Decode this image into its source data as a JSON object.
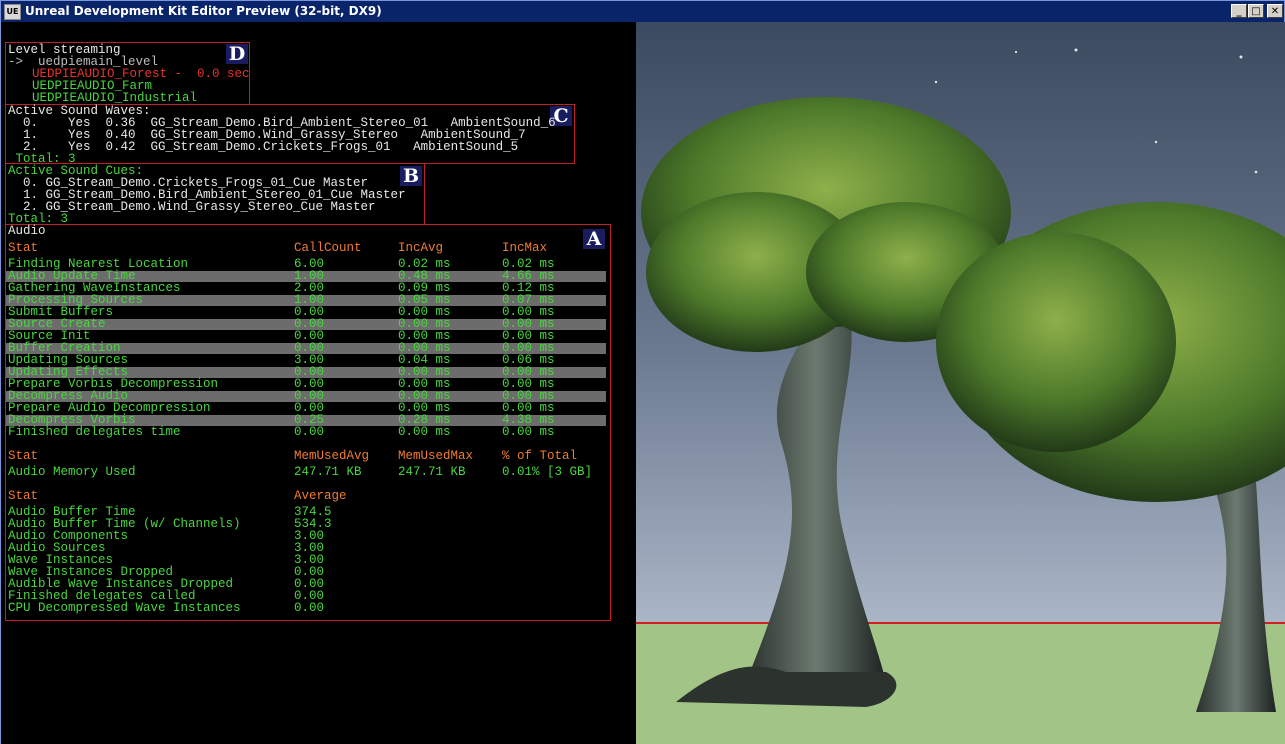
{
  "window": {
    "title": "Unreal Development Kit Editor Preview (32-bit, DX9)",
    "app_icon": "UE",
    "controls": {
      "minimize": "_",
      "maximize": "□",
      "close": "✕"
    }
  },
  "colors": {
    "green": "#49d640",
    "red": "#e8322a",
    "orange": "#f07a30",
    "white": "#e8e8e8",
    "box_border": "#c0202a",
    "tag_bg": "#1a1c60"
  },
  "level_streaming": {
    "tag": "D",
    "title": "Level streaming",
    "main": "->  uedpiemain_level",
    "levels": [
      {
        "text": "UEDPIEAUDIO_Forest -  0.0 sec",
        "color": "red"
      },
      {
        "text": "UEDPIEAUDIO_Farm",
        "color": "green"
      },
      {
        "text": "UEDPIEAUDIO_Industrial",
        "color": "green"
      }
    ]
  },
  "sound_waves": {
    "tag": "C",
    "title": "Active Sound Waves:",
    "rows": [
      "  0.    Yes  0.36  GG_Stream_Demo.Bird_Ambient_Stereo_01   AmbientSound_6",
      "  1.    Yes  0.40  GG_Stream_Demo.Wind_Grassy_Stereo   AmbientSound_7",
      "  2.    Yes  0.42  GG_Stream_Demo.Crickets_Frogs_01   AmbientSound_5"
    ],
    "total": " Total: 3"
  },
  "sound_cues": {
    "tag": "B",
    "title": "Active Sound Cues:",
    "rows": [
      "  0. GG_Stream_Demo.Crickets_Frogs_01_Cue Master",
      "  1. GG_Stream_Demo.Bird_Ambient_Stereo_01_Cue Master",
      "  2. GG_Stream_Demo.Wind_Grassy_Stereo_Cue Master"
    ],
    "total": "Total: 3"
  },
  "audio": {
    "tag": "A",
    "title": "Audio",
    "timing_header": [
      "Stat",
      "CallCount",
      "IncAvg",
      "IncMax"
    ],
    "timing_rows": [
      [
        "Finding Nearest Location",
        "6.00",
        "0.02 ms",
        "0.02 ms"
      ],
      [
        "Audio Update Time",
        "1.00",
        "0.48 ms",
        "4.66 ms"
      ],
      [
        "Gathering WaveInstances",
        "2.00",
        "0.09 ms",
        "0.12 ms"
      ],
      [
        "Processing Sources",
        "1.00",
        "0.05 ms",
        "0.07 ms"
      ],
      [
        "Submit Buffers",
        "0.00",
        "0.00 ms",
        "0.00 ms"
      ],
      [
        "Source Create",
        "0.00",
        "0.00 ms",
        "0.00 ms"
      ],
      [
        "Source Init",
        "0.00",
        "0.00 ms",
        "0.00 ms"
      ],
      [
        "Buffer Creation",
        "0.00",
        "0.00 ms",
        "0.00 ms"
      ],
      [
        "Updating Sources",
        "3.00",
        "0.04 ms",
        "0.06 ms"
      ],
      [
        "Updating Effects",
        "0.00",
        "0.00 ms",
        "0.00 ms"
      ],
      [
        "Prepare Vorbis Decompression",
        "0.00",
        "0.00 ms",
        "0.00 ms"
      ],
      [
        "Decompress Audio",
        "0.00",
        "0.00 ms",
        "0.00 ms"
      ],
      [
        "Prepare Audio Decompression",
        "0.00",
        "0.00 ms",
        "0.00 ms"
      ],
      [
        "Decompress Vorbis",
        "0.25",
        "0.28 ms",
        "4.38 ms"
      ],
      [
        "Finished delegates time",
        "0.00",
        "0.00 ms",
        "0.00 ms"
      ]
    ],
    "memory_header": [
      "Stat",
      "MemUsedAvg",
      "MemUsedMax",
      "% of Total"
    ],
    "memory_rows": [
      [
        "Audio Memory Used",
        "247.71 KB",
        "247.71 KB",
        "0.01% [3 GB]"
      ]
    ],
    "counter_header": [
      "Stat",
      "Average"
    ],
    "counter_rows": [
      [
        "Audio Buffer Time",
        "374.5"
      ],
      [
        "Audio Buffer Time (w/ Channels)",
        "534.3"
      ],
      [
        "Audio Components",
        "3.00"
      ],
      [
        "Audio Sources",
        "3.00"
      ],
      [
        "Wave Instances",
        "3.00"
      ],
      [
        "Wave Instances Dropped",
        "0.00"
      ],
      [
        "Audible Wave Instances Dropped",
        "0.00"
      ],
      [
        "Finished delegates called",
        "0.00"
      ],
      [
        "CPU Decompressed Wave Instances",
        "0.00"
      ]
    ]
  }
}
